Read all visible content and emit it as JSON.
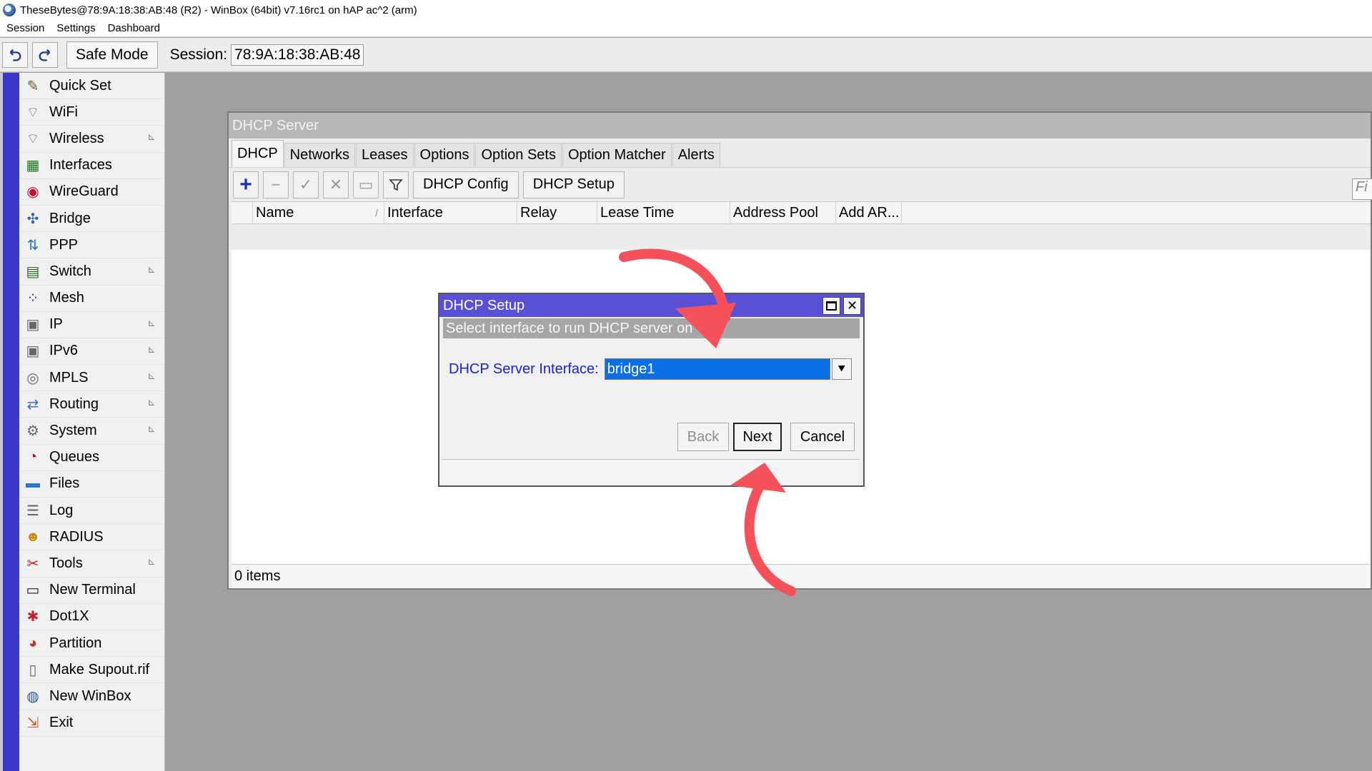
{
  "window_title": "TheseBytes@78:9A:18:38:AB:48 (R2) - WinBox (64bit) v7.16rc1 on hAP ac^2 (arm)",
  "menu": [
    "Session",
    "Settings",
    "Dashboard"
  ],
  "toolbar": {
    "safe_mode_label": "Safe Mode",
    "session_label": "Session:",
    "session_value": "78:9A:18:38:AB:48"
  },
  "sidebar": {
    "items": [
      {
        "label": "Quick Set",
        "icon": "magic-wand-icon",
        "submenu": false
      },
      {
        "label": "WiFi",
        "icon": "wifi-antenna-icon",
        "submenu": false
      },
      {
        "label": "Wireless",
        "icon": "wireless-antenna-icon",
        "submenu": true
      },
      {
        "label": "Interfaces",
        "icon": "network-card-icon",
        "submenu": false
      },
      {
        "label": "WireGuard",
        "icon": "wireguard-icon",
        "submenu": false
      },
      {
        "label": "Bridge",
        "icon": "bridge-icon",
        "submenu": false
      },
      {
        "label": "PPP",
        "icon": "ppp-icon",
        "submenu": false
      },
      {
        "label": "Switch",
        "icon": "switch-icon",
        "submenu": true
      },
      {
        "label": "Mesh",
        "icon": "mesh-icon",
        "submenu": false
      },
      {
        "label": "IP",
        "icon": "ip-icon",
        "submenu": true
      },
      {
        "label": "IPv6",
        "icon": "ipv6-icon",
        "submenu": true
      },
      {
        "label": "MPLS",
        "icon": "mpls-icon",
        "submenu": true
      },
      {
        "label": "Routing",
        "icon": "routing-icon",
        "submenu": true
      },
      {
        "label": "System",
        "icon": "gear-icon",
        "submenu": true
      },
      {
        "label": "Queues",
        "icon": "gauge-icon",
        "submenu": false
      },
      {
        "label": "Files",
        "icon": "folder-icon",
        "submenu": false
      },
      {
        "label": "Log",
        "icon": "log-icon",
        "submenu": false
      },
      {
        "label": "RADIUS",
        "icon": "users-icon",
        "submenu": false
      },
      {
        "label": "Tools",
        "icon": "tools-icon",
        "submenu": true
      },
      {
        "label": "New Terminal",
        "icon": "terminal-icon",
        "submenu": false
      },
      {
        "label": "Dot1X",
        "icon": "dot1x-icon",
        "submenu": false
      },
      {
        "label": "Partition",
        "icon": "pie-chart-icon",
        "submenu": false
      },
      {
        "label": "Make Supout.rif",
        "icon": "document-icon",
        "submenu": false
      },
      {
        "label": "New WinBox",
        "icon": "winbox-icon",
        "submenu": false
      },
      {
        "label": "Exit",
        "icon": "exit-icon",
        "submenu": false
      }
    ]
  },
  "dhcp_window": {
    "title": "DHCP Server",
    "tabs": [
      "DHCP",
      "Networks",
      "Leases",
      "Options",
      "Option Sets",
      "Option Matcher",
      "Alerts"
    ],
    "active_tab": "DHCP",
    "buttons": {
      "dhcp_config": "DHCP Config",
      "dhcp_setup": "DHCP Setup"
    },
    "find_placeholder": "Fi",
    "columns": [
      "Name",
      "Interface",
      "Relay",
      "Lease Time",
      "Address Pool",
      "Add AR..."
    ],
    "status": "0 items"
  },
  "setup_dialog": {
    "title": "DHCP Setup",
    "banner": "Select interface to run DHCP server on",
    "field_label": "DHCP Server Interface:",
    "field_value": "bridge1",
    "back": "Back",
    "next": "Next",
    "cancel": "Cancel"
  },
  "colors": {
    "sidebar_strip": "#3b35c9",
    "dialog_title": "#5a50d6",
    "selection": "#0a6ee6",
    "field_label": "#1e1ed0",
    "annotation_arrow": "#f4515a"
  }
}
